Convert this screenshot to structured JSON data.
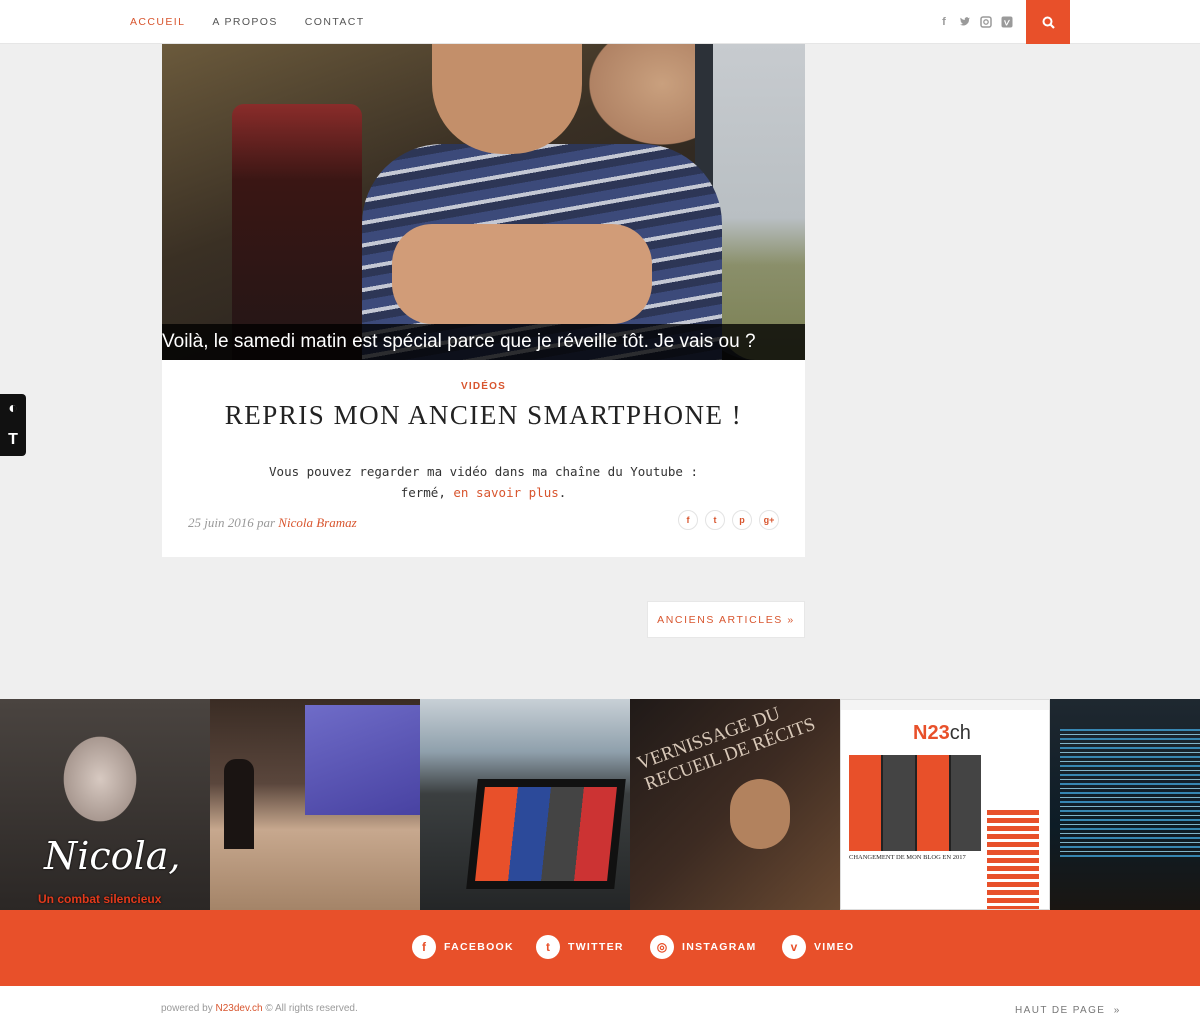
{
  "nav": {
    "items": [
      {
        "label": "ACCUEIL",
        "active": true
      },
      {
        "label": "A PROPOS",
        "active": false
      },
      {
        "label": "CONTACT",
        "active": false
      }
    ],
    "social_icons": [
      "facebook-icon",
      "twitter-icon",
      "instagram-icon",
      "vimeo-icon"
    ],
    "search_icon": "search-icon"
  },
  "post": {
    "video_caption": "Voilà, le samedi matin est spécial parce que je réveille tôt. Je vais ou ?",
    "category": "VIDÉOS",
    "title": "REPRIS MON ANCIEN SMARTPHONE !",
    "excerpt_line1": "Vous pouvez regarder ma vidéo dans ma chaîne du Youtube :",
    "excerpt_line2_prefix": "fermé,",
    "read_more": "en savoir plus",
    "excerpt_suffix": ".",
    "date": "25 juin 2016",
    "by": "par",
    "author": "Nicola Bramaz",
    "share_icons": [
      "facebook-icon",
      "twitter-icon",
      "pinterest-icon",
      "google-plus-icon"
    ]
  },
  "pagination": {
    "older_label": "ANCIENS ARTICLES »"
  },
  "gallery": {
    "tile1_title": "Nicola,",
    "tile1_subtitle": "Un combat silencieux",
    "tile4_text": "VERNISSAGE DU RECUEIL DE RÉCITS",
    "tile5_logo_main": "N23",
    "tile5_logo_suffix": "ch",
    "tile5_caption": "CHANGEMENT DE MON BLOG EN 2017"
  },
  "social_bar": [
    {
      "icon": "facebook-icon",
      "label": "FACEBOOK"
    },
    {
      "icon": "twitter-icon",
      "label": "TWITTER"
    },
    {
      "icon": "instagram-icon",
      "label": "INSTAGRAM"
    },
    {
      "icon": "vimeo-icon",
      "label": "VIMEO"
    }
  ],
  "footer": {
    "powered_prefix": "powered by",
    "powered_link": "N23dev.ch",
    "rights": "© All rights reserved.",
    "back_to_top": "HAUT DE PAGE"
  },
  "colors": {
    "accent": "#e8502a",
    "background": "#efefef"
  }
}
